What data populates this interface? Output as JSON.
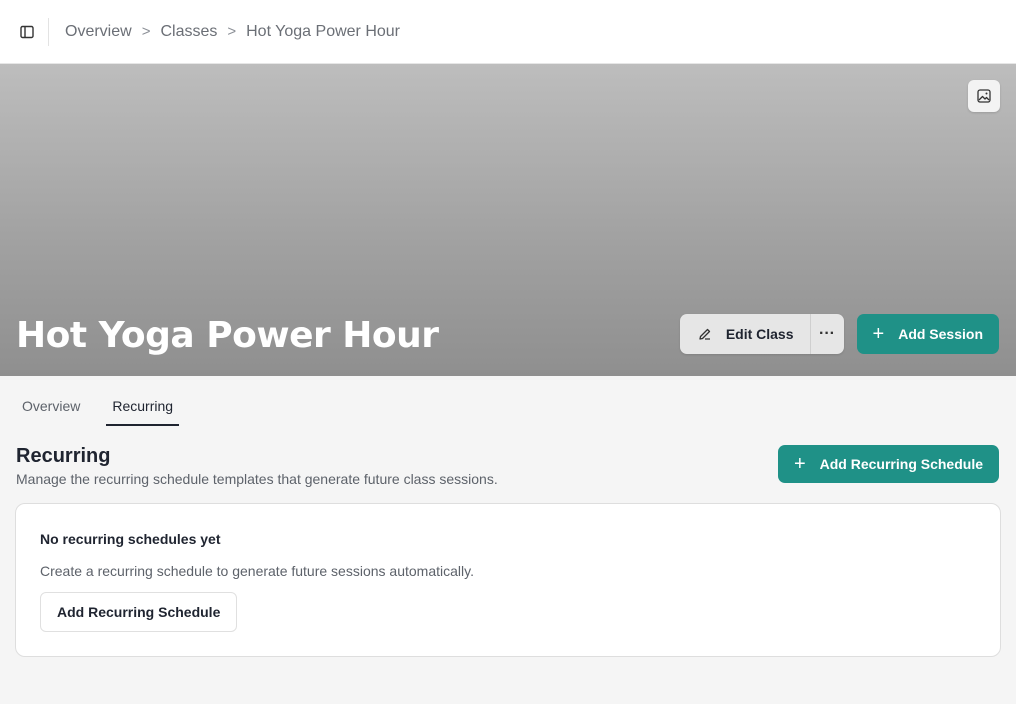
{
  "breadcrumb": {
    "items": [
      "Overview",
      "Classes",
      "Hot Yoga Power Hour"
    ],
    "separator": ">"
  },
  "hero": {
    "title": "Hot Yoga Power Hour",
    "image_button_icon": "image-icon",
    "edit_label": "Edit Class",
    "more_label": "···",
    "add_session_label": "Add Session"
  },
  "tabs": [
    {
      "label": "Overview",
      "active": false
    },
    {
      "label": "Recurring",
      "active": true
    }
  ],
  "section": {
    "title": "Recurring",
    "subtitle": "Manage the recurring schedule templates that generate future class sessions.",
    "add_button_label": "Add Recurring Schedule"
  },
  "empty_state": {
    "title": "No recurring schedules yet",
    "description": "Create a recurring schedule to generate future sessions automatically.",
    "button_label": "Add Recurring Schedule"
  },
  "colors": {
    "primary": "#1f9187",
    "page_bg": "#f5f5f5"
  }
}
